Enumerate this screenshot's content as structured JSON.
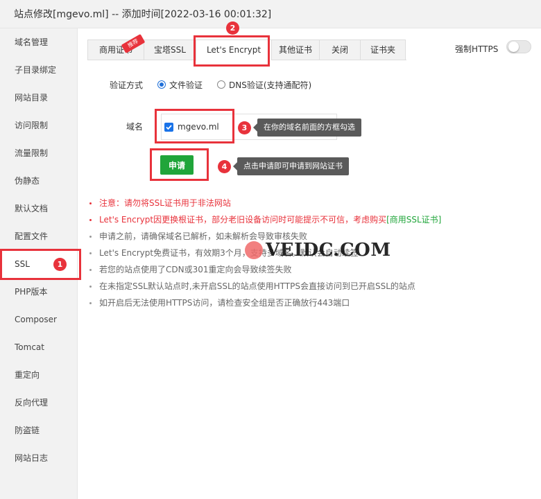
{
  "window": {
    "title": "站点修改[mgevo.ml] -- 添加时间[2022-03-16 00:01:32]"
  },
  "sidebar": {
    "items": [
      {
        "label": "域名管理"
      },
      {
        "label": "子目录绑定"
      },
      {
        "label": "网站目录"
      },
      {
        "label": "访问限制"
      },
      {
        "label": "流量限制"
      },
      {
        "label": "伪静态"
      },
      {
        "label": "默认文档"
      },
      {
        "label": "配置文件"
      },
      {
        "label": "SSL"
      },
      {
        "label": "PHP版本"
      },
      {
        "label": "Composer"
      },
      {
        "label": "Tomcat"
      },
      {
        "label": "重定向"
      },
      {
        "label": "反向代理"
      },
      {
        "label": "防盗链"
      },
      {
        "label": "网站日志"
      }
    ],
    "active_index": 8
  },
  "tabs": {
    "items": [
      {
        "label": "商用证书"
      },
      {
        "label": "宝塔SSL"
      },
      {
        "label": "Let's Encrypt"
      },
      {
        "label": "其他证书"
      },
      {
        "label": "关闭"
      },
      {
        "label": "证书夹"
      }
    ],
    "active_index": 2,
    "ribbon_label": "推荐"
  },
  "force_https": {
    "label": "强制HTTPS",
    "enabled": false
  },
  "verify": {
    "label": "验证方式",
    "options": [
      {
        "label": "文件验证",
        "checked": true
      },
      {
        "label": "DNS验证(支持通配符)",
        "checked": false
      }
    ]
  },
  "domain": {
    "label": "域名",
    "value": "mgevo.ml",
    "checked": true
  },
  "apply_button": {
    "label": "申请"
  },
  "annotations": {
    "badges": [
      "1",
      "2",
      "3",
      "4"
    ],
    "tip3": "在你的域名前面的方框勾选",
    "tip4": "点击申请即可申请到网站证书"
  },
  "notes": [
    {
      "text": "注意：请勿将SSL证书用于非法网站"
    },
    {
      "text": "Let's Encrypt因更换根证书，部分老旧设备访问时可能提示不可信，考虑购买",
      "link": "[商用SSL证书]"
    },
    {
      "text": "申请之前，请确保域名已解析，如未解析会导致审核失败"
    },
    {
      "text": "Let's Encrypt免费证书，有效期3个月，支持多域名。默认会自动续签"
    },
    {
      "text": "若您的站点使用了CDN或301重定向会导致续签失败"
    },
    {
      "text": "在未指定SSL默认站点时,未开启SSL的站点使用HTTPS会直接访问到已开启SSL的站点"
    },
    {
      "text": "如开启后无法使用HTTPS访问，请检查安全组是否正确放行443端口"
    }
  ],
  "watermark": {
    "text": "VEIDC.COM"
  },
  "colors": {
    "accent_green": "#20a53a",
    "annotation_red": "#e8323b",
    "checkbox_blue": "#1a73e8"
  }
}
